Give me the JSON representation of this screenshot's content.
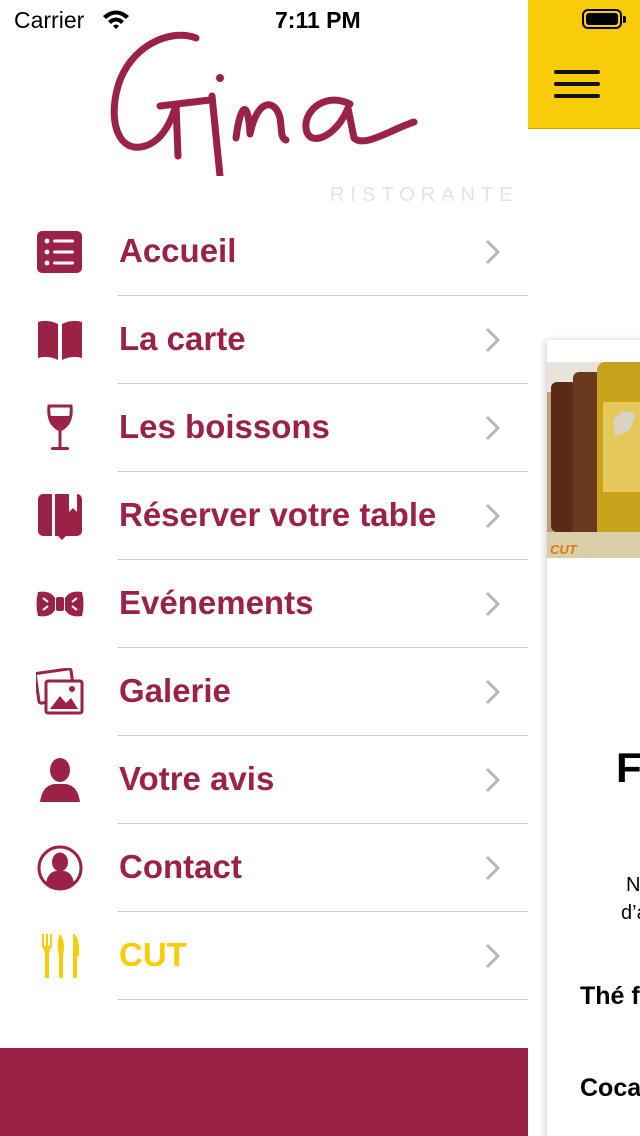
{
  "status_bar": {
    "carrier": "Carrier",
    "time": "7:11 PM"
  },
  "brand": {
    "name": "Gina",
    "subtitle": "RISTORANTE",
    "primary_color": "#9b2247",
    "accent_color": "#f9cc0a"
  },
  "menu": {
    "items": [
      {
        "label": "Accueil",
        "icon": "list-icon"
      },
      {
        "label": "La carte",
        "icon": "book-icon"
      },
      {
        "label": "Les boissons",
        "icon": "wine-glass-icon"
      },
      {
        "label": "Réserver votre table",
        "icon": "booking-icon"
      },
      {
        "label": "Evénements",
        "icon": "bow-tie-icon"
      },
      {
        "label": "Galerie",
        "icon": "gallery-icon"
      },
      {
        "label": "Votre avis",
        "icon": "person-icon"
      },
      {
        "label": "Contact",
        "icon": "contact-icon"
      },
      {
        "label": "CUT",
        "icon": "cutlery-icon"
      }
    ]
  },
  "background_screen": {
    "title_partial": "F",
    "line1_partial": "N",
    "line2_partial": "d’a",
    "item1_partial": "Thé f",
    "item2_partial": "Coca",
    "photo_label": "CUT"
  }
}
